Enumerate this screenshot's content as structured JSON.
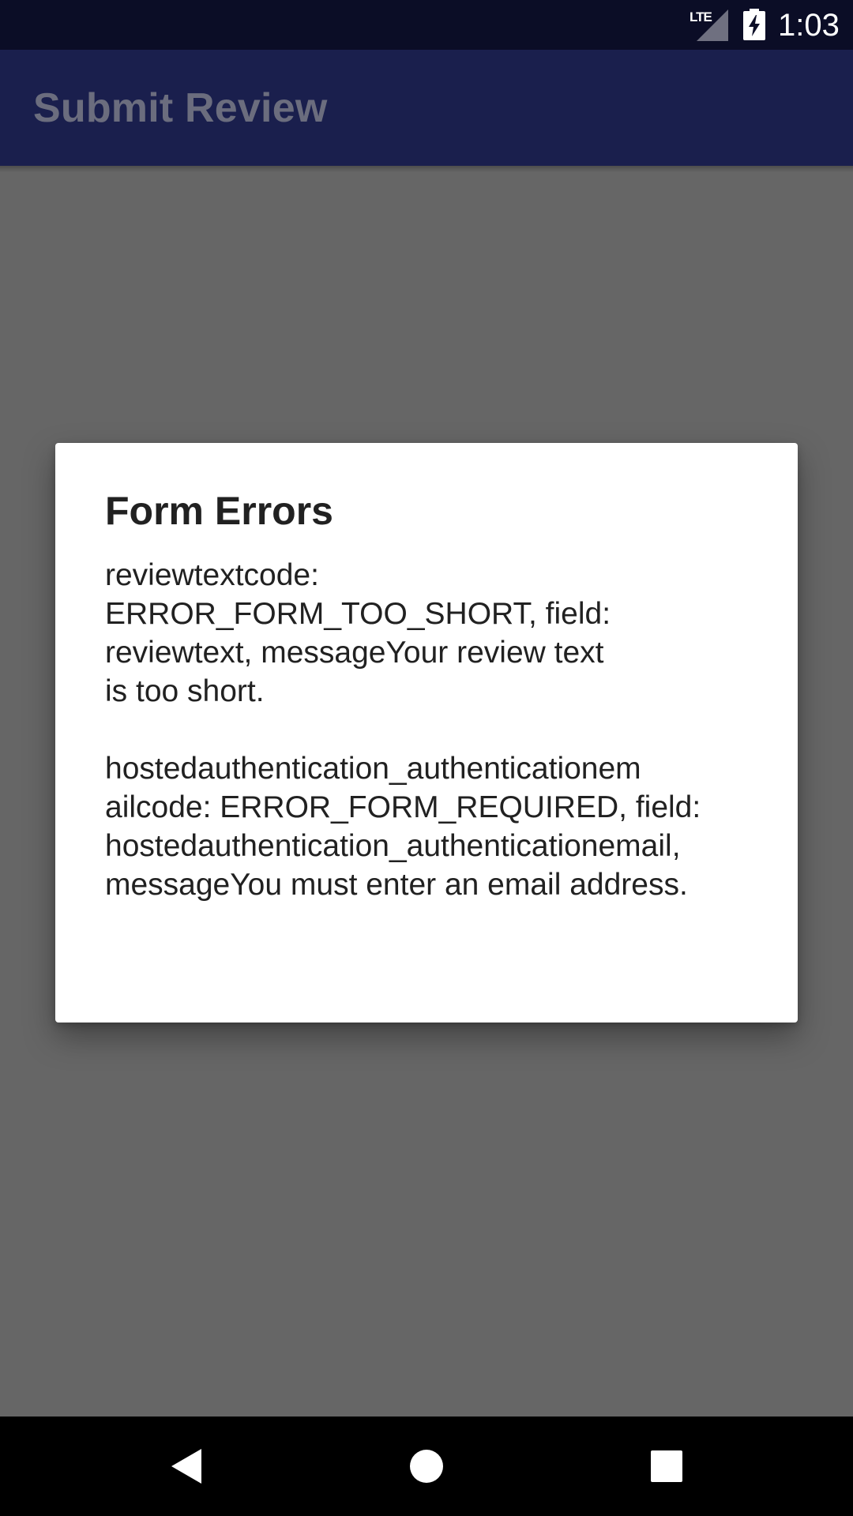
{
  "status_bar": {
    "network": "LTE",
    "time": "1:03",
    "icons": [
      "lte-signal-icon",
      "battery-charging-icon"
    ]
  },
  "app_bar": {
    "title": "Submit Review"
  },
  "dialog": {
    "title": "Form Errors",
    "errors": [
      "reviewtextcode:\nERROR_FORM_TOO_SHORT, field:\nreviewtext, messageYour review text\nis too short.",
      "hostedauthentication_authenticationem\nailcode: ERROR_FORM_REQUIRED, field:\nhostedauthentication_authenticationemail,\nmessageYou must enter an email address."
    ]
  },
  "nav_bar": {
    "icons": [
      "back-icon",
      "home-icon",
      "recents-icon"
    ]
  },
  "colors": {
    "status_bar": "#0b0d26",
    "app_bar": "#1a1f4d",
    "scrim": "#666666",
    "dialog": "#ffffff",
    "nav_bar": "#000000"
  }
}
